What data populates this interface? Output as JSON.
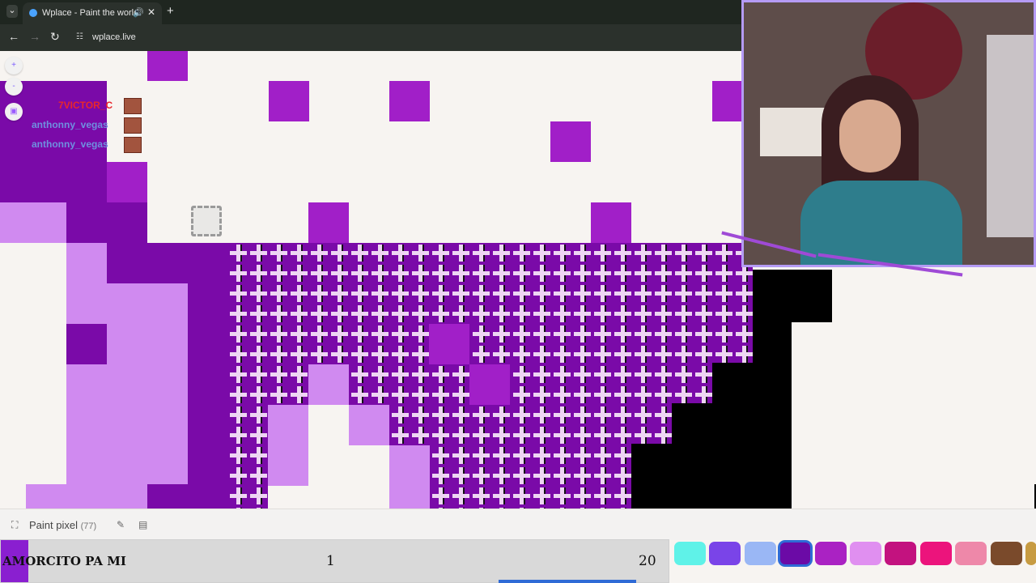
{
  "browser": {
    "tab_title": "Wplace - Paint the world",
    "url": "wplace.live",
    "icons": {
      "tab_list": "chevron-down-icon",
      "favicon": "globe-icon",
      "audio": "speaker-icon",
      "close": "close-icon",
      "new_tab": "plus-icon",
      "back": "back-arrow-icon",
      "forward": "forward-arrow-icon",
      "reload": "reload-icon",
      "site_info": "tune-icon"
    }
  },
  "tools": {
    "zoom_in": "+",
    "zoom_out": "-",
    "twitch": "twitch-icon"
  },
  "chat": [
    {
      "user": "7VICTOR_C",
      "color": "#e8262c"
    },
    {
      "user": "anthonny_vegas",
      "color": "#6f8fe0"
    },
    {
      "user": "anthonny_vegas",
      "color": "#6f8fe0"
    }
  ],
  "paint_bar": {
    "label": "Paint pixel",
    "count": "(77)",
    "icons": [
      "fullscreen-icon",
      "pencil-icon",
      "layout-icon"
    ]
  },
  "overlay": {
    "name": "AMORCITO PA MI",
    "value_1": "1",
    "value_2": "20"
  },
  "palette": [
    "#5ff2e8",
    "#7a44e8",
    "#9ab7f5",
    "#6b0aa6",
    "#aa22c3",
    "#e08ff0",
    "#c3127f",
    "#ec147c",
    "#ee88a9",
    "#7a4a2b",
    "#c79b42"
  ],
  "palette_selected_index": 3,
  "colors": {
    "purple_dark": "#7a0aa8",
    "purple_mid": "#a11fc8",
    "purple_light": "#d08af0",
    "cream": "#f7f4f1"
  }
}
